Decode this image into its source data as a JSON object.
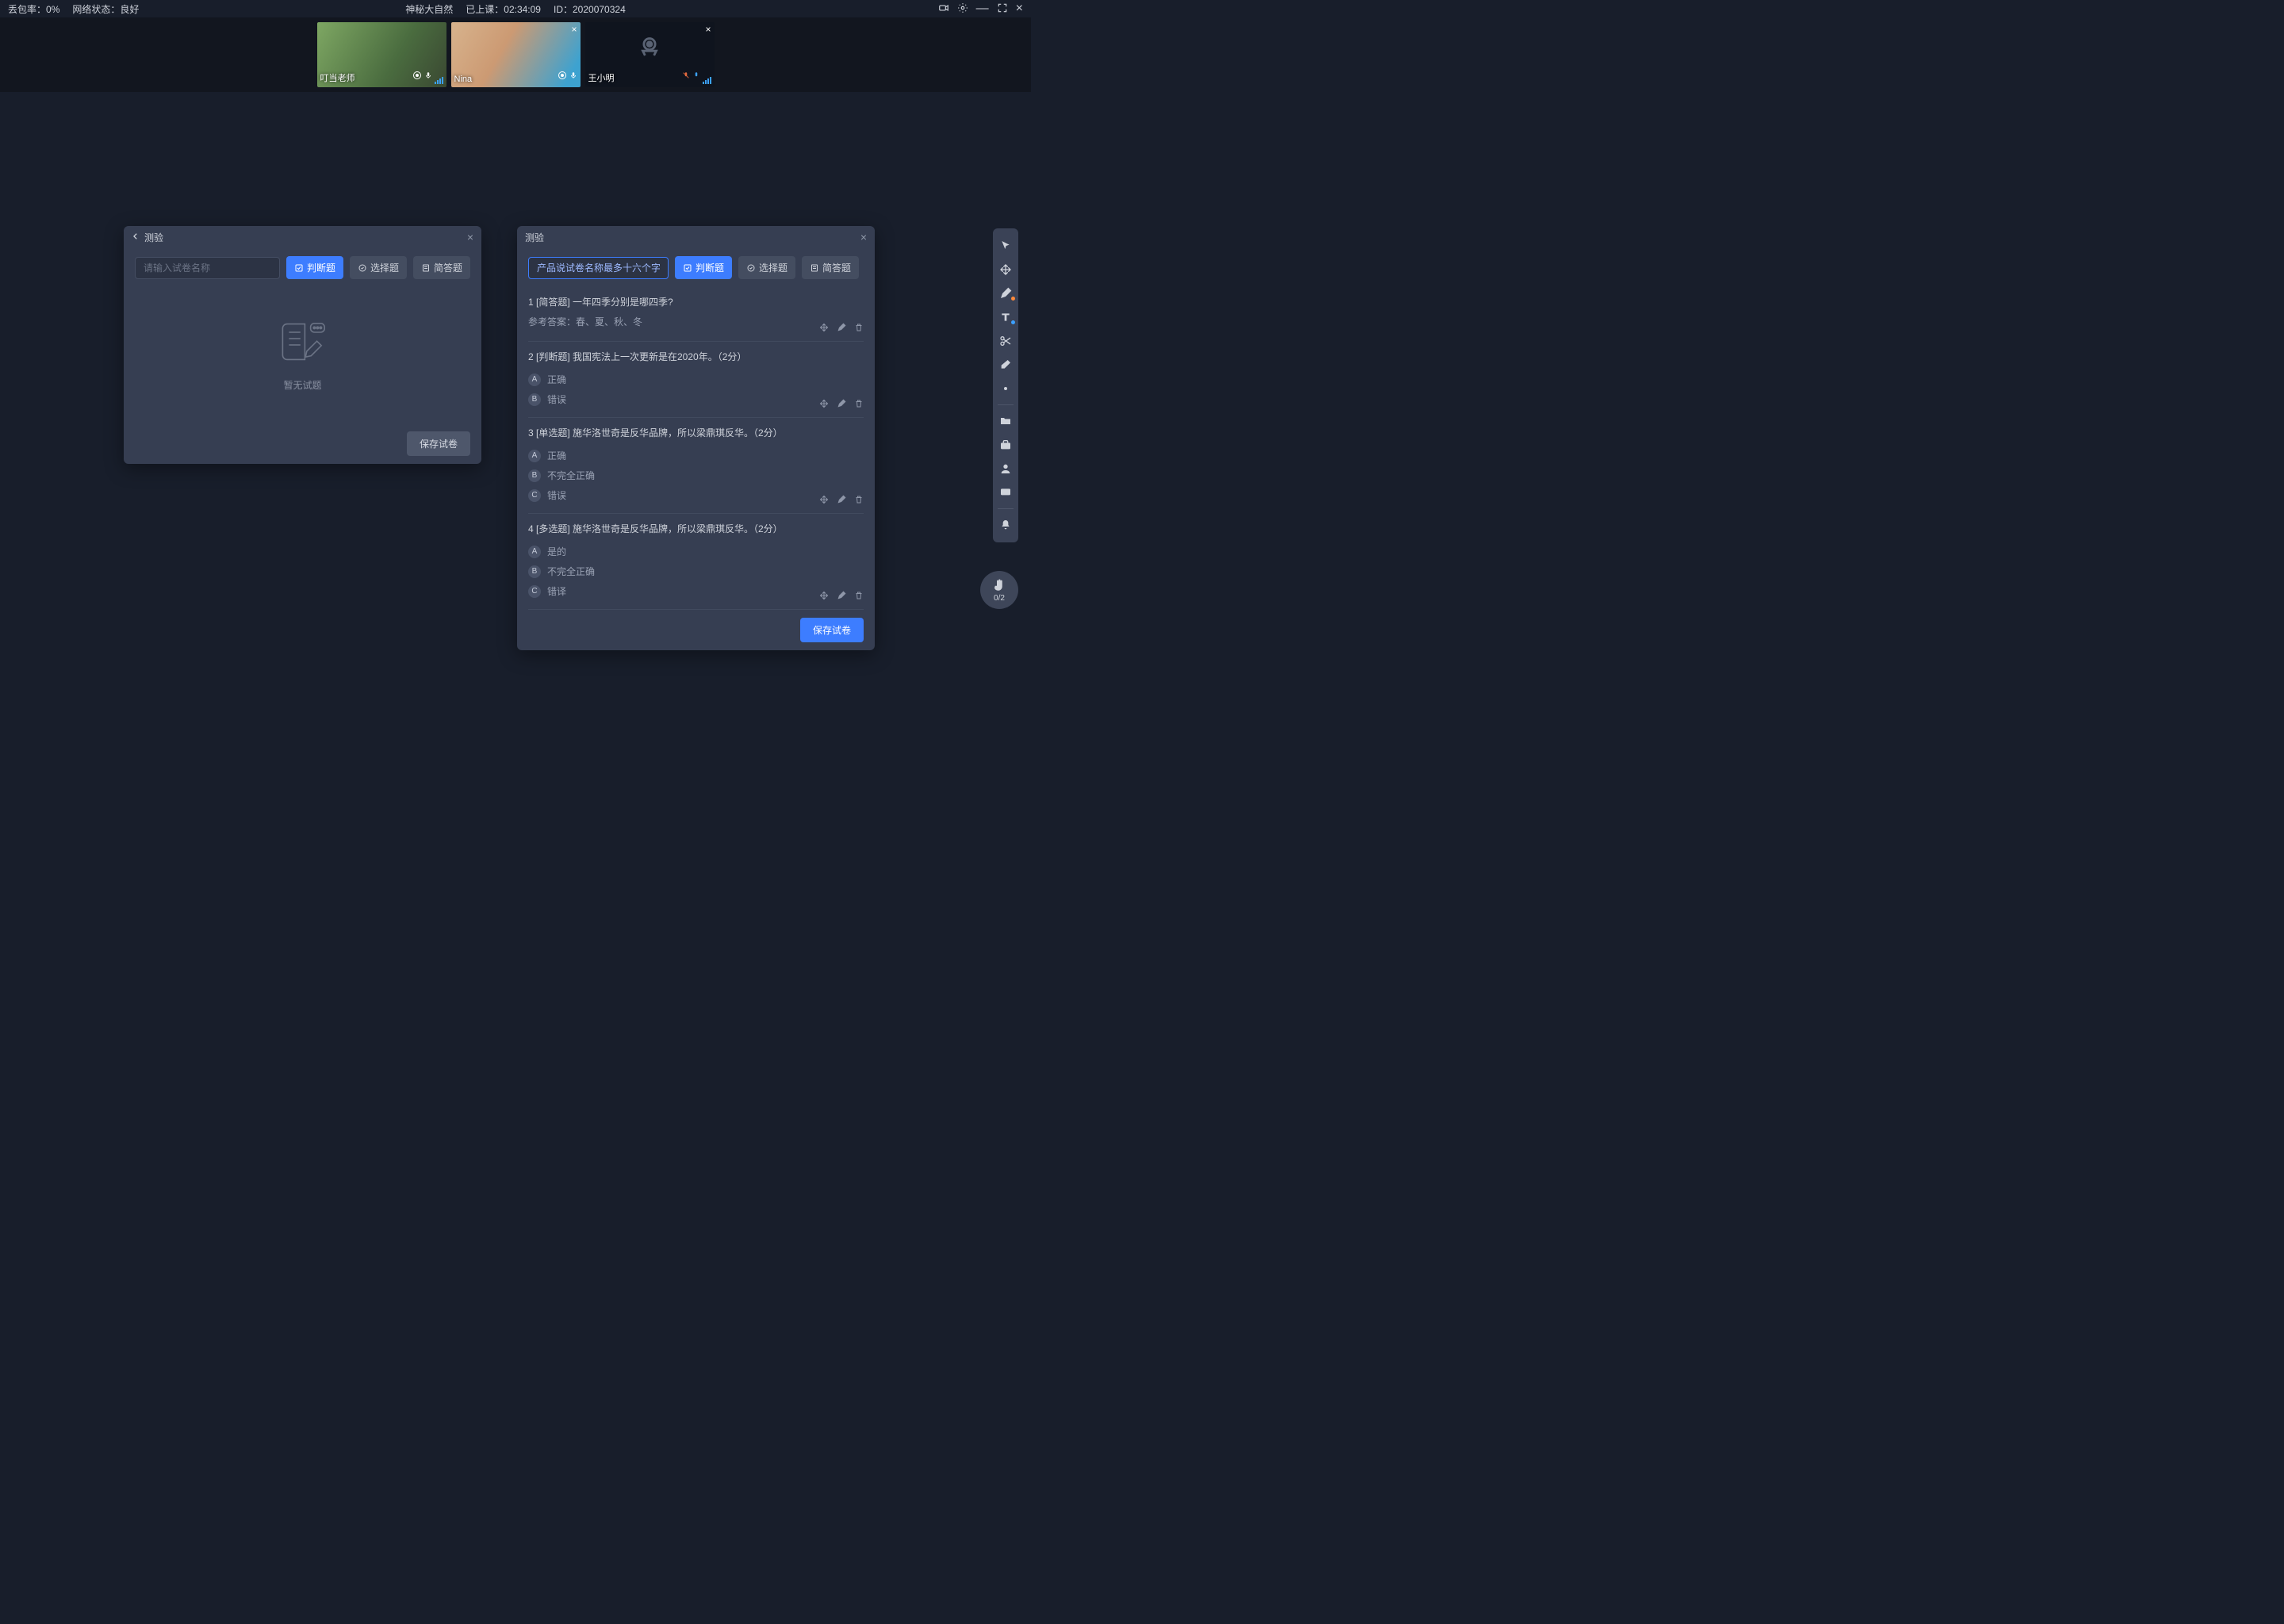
{
  "topbar": {
    "loss_label": "丢包率：",
    "loss_value": "0%",
    "net_label": "网络状态：",
    "net_value": "良好",
    "course_name": "神秘大自然",
    "elapsed_label": "已上课：",
    "elapsed_value": "02:34:09",
    "id_label": "ID：",
    "id_value": "2020070324"
  },
  "video": {
    "tiles": [
      {
        "name": "叮当老师",
        "closable": false,
        "dark": false
      },
      {
        "name": "Nina",
        "closable": true,
        "dark": false
      },
      {
        "name": "王小明",
        "closable": true,
        "dark": true
      }
    ]
  },
  "panel_left": {
    "title": "测验",
    "input_placeholder": "请输入试卷名称",
    "btn_judge": "判断题",
    "btn_choice": "选择题",
    "btn_short": "简答题",
    "empty_text": "暂无试题",
    "save_label": "保存试卷"
  },
  "panel_right": {
    "title": "测验",
    "name_value": "产品说试卷名称最多十六个字",
    "btn_judge": "判断题",
    "btn_choice": "选择题",
    "btn_short": "简答题",
    "save_label": "保存试卷",
    "questions": [
      {
        "title": "1 [简答题] 一年四季分别是哪四季?",
        "answer": "参考答案：春、夏、秋、冬"
      },
      {
        "title": "2 [判断题] 我国宪法上一次更新是在2020年。（2分）",
        "options": [
          {
            "badge": "A",
            "text": "正确"
          },
          {
            "badge": "B",
            "text": "错误"
          }
        ]
      },
      {
        "title": "3 [单选题] 施华洛世奇是反华品牌，所以梁鼎琪反华。（2分）",
        "options": [
          {
            "badge": "A",
            "text": "正确"
          },
          {
            "badge": "B",
            "text": "不完全正确"
          },
          {
            "badge": "C",
            "text": "错误"
          }
        ]
      },
      {
        "title": "4 [多选题] 施华洛世奇是反华品牌，所以梁鼎琪反华。（2分）",
        "options": [
          {
            "badge": "A",
            "text": "是的"
          },
          {
            "badge": "B",
            "text": "不完全正确"
          },
          {
            "badge": "C",
            "text": "错译"
          }
        ]
      }
    ]
  },
  "hand": {
    "count": "0/2"
  }
}
